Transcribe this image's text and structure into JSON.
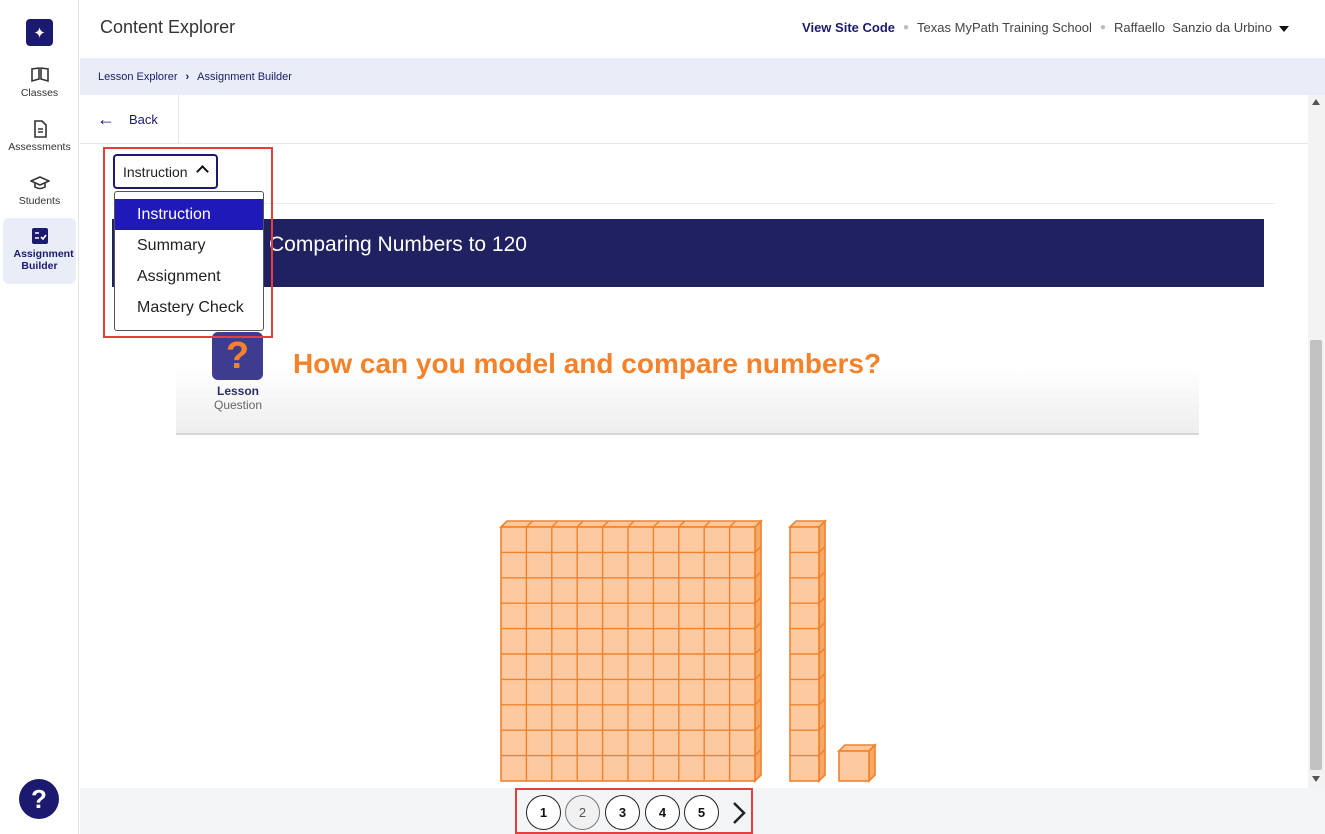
{
  "sidebar": {
    "items": [
      {
        "label": "Classes",
        "icon": "book-icon"
      },
      {
        "label": "Assessments",
        "icon": "document-icon"
      },
      {
        "label": "Students",
        "icon": "graduation-cap-icon"
      },
      {
        "label": "Assignment Builder",
        "icon": "checklist-icon",
        "active": true
      }
    ],
    "help_label": "?"
  },
  "header": {
    "title": "Content Explorer",
    "view_site_code": "View Site Code",
    "school": "Texas MyPath Training School",
    "user": "Raffaello  Sanzio da Urbino"
  },
  "breadcrumb": {
    "items": [
      "Lesson Explorer",
      "Assignment Builder"
    ]
  },
  "back": {
    "label": "Back"
  },
  "dropdown": {
    "selected": "Instruction",
    "options": [
      "Instruction",
      "Summary",
      "Assignment",
      "Mastery Check"
    ]
  },
  "lesson": {
    "title": "Comparing Numbers to 120",
    "question_label_1": "Lesson",
    "question_label_2": "Question",
    "question_text": "How can you model and compare numbers?"
  },
  "pager": {
    "pages": [
      "1",
      "2",
      "3",
      "4",
      "5"
    ],
    "current": "2",
    "next_label": "next"
  },
  "colors": {
    "brand_navy": "#1c1a6e",
    "banner": "#1f2160",
    "accent_orange": "#f5822a",
    "highlight_red": "#e53e3e",
    "selected_option": "#1f19b9"
  }
}
